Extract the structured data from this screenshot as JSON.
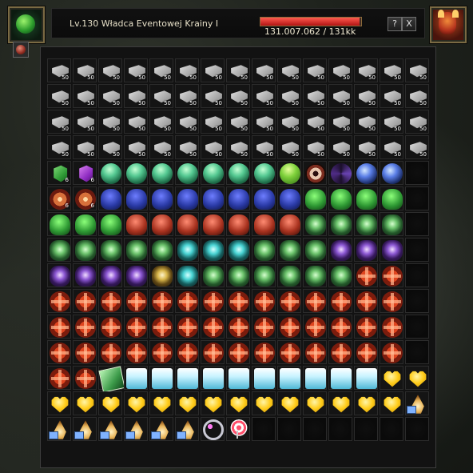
{
  "header": {
    "player_name": "Lv.130 Władca Eventowej Krainy I",
    "hp_text": "131.007.062 / 131kk",
    "hp_fraction": 0.985,
    "help_label": "?",
    "close_label": "X"
  },
  "inventory": {
    "cells": [
      {
        "type": "ingot",
        "qty": "50"
      },
      {
        "type": "ingot",
        "qty": "50"
      },
      {
        "type": "ingot",
        "qty": "50"
      },
      {
        "type": "ingot",
        "qty": "50"
      },
      {
        "type": "ingot",
        "qty": "50"
      },
      {
        "type": "ingot",
        "qty": "50"
      },
      {
        "type": "ingot",
        "qty": "50"
      },
      {
        "type": "ingot",
        "qty": "50"
      },
      {
        "type": "ingot",
        "qty": "50"
      },
      {
        "type": "ingot",
        "qty": "50"
      },
      {
        "type": "ingot",
        "qty": "50"
      },
      {
        "type": "ingot",
        "qty": "50"
      },
      {
        "type": "ingot",
        "qty": "50"
      },
      {
        "type": "ingot",
        "qty": "50"
      },
      {
        "type": "ingot",
        "qty": "50"
      },
      {
        "type": "ingot",
        "qty": "50"
      },
      {
        "type": "ingot",
        "qty": "50"
      },
      {
        "type": "ingot",
        "qty": "50"
      },
      {
        "type": "ingot",
        "qty": "50"
      },
      {
        "type": "ingot",
        "qty": "50"
      },
      {
        "type": "ingot",
        "qty": "50"
      },
      {
        "type": "ingot",
        "qty": "50"
      },
      {
        "type": "ingot",
        "qty": "50"
      },
      {
        "type": "ingot",
        "qty": "50"
      },
      {
        "type": "ingot",
        "qty": "50"
      },
      {
        "type": "ingot",
        "qty": "50"
      },
      {
        "type": "ingot",
        "qty": "50"
      },
      {
        "type": "ingot",
        "qty": "50"
      },
      {
        "type": "ingot",
        "qty": "50"
      },
      {
        "type": "ingot",
        "qty": "50"
      },
      {
        "type": "ingot",
        "qty": "50"
      },
      {
        "type": "ingot",
        "qty": "50"
      },
      {
        "type": "ingot",
        "qty": "50"
      },
      {
        "type": "ingot",
        "qty": "50"
      },
      {
        "type": "ingot",
        "qty": "50"
      },
      {
        "type": "ingot",
        "qty": "50"
      },
      {
        "type": "ingot",
        "qty": "50"
      },
      {
        "type": "ingot",
        "qty": "50"
      },
      {
        "type": "ingot",
        "qty": "50"
      },
      {
        "type": "ingot",
        "qty": "50"
      },
      {
        "type": "ingot",
        "qty": "50"
      },
      {
        "type": "ingot",
        "qty": "50"
      },
      {
        "type": "ingot",
        "qty": "50"
      },
      {
        "type": "ingot",
        "qty": "50"
      },
      {
        "type": "ingot",
        "qty": "50"
      },
      {
        "type": "ingot",
        "qty": "50"
      },
      {
        "type": "ingot",
        "qty": "50"
      },
      {
        "type": "ingot",
        "qty": "50"
      },
      {
        "type": "ingot",
        "qty": "50"
      },
      {
        "type": "ingot",
        "qty": "50"
      },
      {
        "type": "ingot",
        "qty": "50"
      },
      {
        "type": "ingot",
        "qty": "50"
      },
      {
        "type": "ingot",
        "qty": "50"
      },
      {
        "type": "ingot",
        "qty": "50"
      },
      {
        "type": "ingot",
        "qty": "50"
      },
      {
        "type": "ingot",
        "qty": "50"
      },
      {
        "type": "ingot",
        "qty": "50"
      },
      {
        "type": "ingot",
        "qty": "50"
      },
      {
        "type": "ingot",
        "qty": "50"
      },
      {
        "type": "ingot",
        "qty": "50"
      },
      {
        "type": "cube-green",
        "qty": "6"
      },
      {
        "type": "cube-purple",
        "qty": "6"
      },
      {
        "type": "gem-green",
        "qty": ""
      },
      {
        "type": "gem-green",
        "qty": ""
      },
      {
        "type": "gem-green",
        "qty": ""
      },
      {
        "type": "gem-green",
        "qty": ""
      },
      {
        "type": "gem-green",
        "qty": ""
      },
      {
        "type": "gem-green",
        "qty": ""
      },
      {
        "type": "gem-green",
        "qty": ""
      },
      {
        "type": "gem-lime",
        "qty": ""
      },
      {
        "type": "eye",
        "qty": ""
      },
      {
        "type": "vortex",
        "qty": ""
      },
      {
        "type": "orb-blue",
        "qty": ""
      },
      {
        "type": "orb-blue",
        "qty": ""
      },
      {
        "type": "empty",
        "qty": ""
      },
      {
        "type": "flower",
        "qty": "6"
      },
      {
        "type": "flower",
        "qty": "6"
      },
      {
        "type": "flask-blue",
        "qty": ""
      },
      {
        "type": "flask-blue",
        "qty": ""
      },
      {
        "type": "flask-blue",
        "qty": ""
      },
      {
        "type": "flask-blue",
        "qty": ""
      },
      {
        "type": "flask-blue",
        "qty": ""
      },
      {
        "type": "flask-blue",
        "qty": ""
      },
      {
        "type": "flask-blue",
        "qty": ""
      },
      {
        "type": "flask-blue",
        "qty": ""
      },
      {
        "type": "flask-green",
        "qty": ""
      },
      {
        "type": "flask-green",
        "qty": ""
      },
      {
        "type": "flask-green",
        "qty": ""
      },
      {
        "type": "flask-green",
        "qty": ""
      },
      {
        "type": "empty",
        "qty": ""
      },
      {
        "type": "flask-green",
        "qty": ""
      },
      {
        "type": "flask-green",
        "qty": ""
      },
      {
        "type": "flask-green",
        "qty": ""
      },
      {
        "type": "flask-red",
        "qty": ""
      },
      {
        "type": "flask-red",
        "qty": ""
      },
      {
        "type": "flask-red",
        "qty": ""
      },
      {
        "type": "flask-red",
        "qty": ""
      },
      {
        "type": "flask-red",
        "qty": ""
      },
      {
        "type": "flask-red",
        "qty": ""
      },
      {
        "type": "flask-red",
        "qty": ""
      },
      {
        "type": "cage",
        "qty": ""
      },
      {
        "type": "cage",
        "qty": ""
      },
      {
        "type": "cage",
        "qty": ""
      },
      {
        "type": "cage",
        "qty": ""
      },
      {
        "type": "empty",
        "qty": ""
      },
      {
        "type": "cage",
        "qty": ""
      },
      {
        "type": "cage",
        "qty": ""
      },
      {
        "type": "cage",
        "qty": ""
      },
      {
        "type": "cage",
        "qty": ""
      },
      {
        "type": "cage",
        "qty": ""
      },
      {
        "type": "cage-cyan",
        "qty": ""
      },
      {
        "type": "cage-cyan",
        "qty": ""
      },
      {
        "type": "cage-cyan",
        "qty": ""
      },
      {
        "type": "cage",
        "qty": ""
      },
      {
        "type": "cage",
        "qty": ""
      },
      {
        "type": "cage",
        "qty": ""
      },
      {
        "type": "cage-purple",
        "qty": ""
      },
      {
        "type": "cage-purple",
        "qty": ""
      },
      {
        "type": "cage-purple",
        "qty": ""
      },
      {
        "type": "empty",
        "qty": ""
      },
      {
        "type": "cage-purple",
        "qty": ""
      },
      {
        "type": "cage-purple",
        "qty": ""
      },
      {
        "type": "cage-purple",
        "qty": ""
      },
      {
        "type": "cage-purple",
        "qty": ""
      },
      {
        "type": "cage-yellow",
        "qty": ""
      },
      {
        "type": "cage-cyan",
        "qty": ""
      },
      {
        "type": "cage",
        "qty": ""
      },
      {
        "type": "cage",
        "qty": ""
      },
      {
        "type": "cage",
        "qty": ""
      },
      {
        "type": "cage",
        "qty": ""
      },
      {
        "type": "cage",
        "qty": ""
      },
      {
        "type": "cage",
        "qty": ""
      },
      {
        "type": "cross",
        "qty": ""
      },
      {
        "type": "cross",
        "qty": ""
      },
      {
        "type": "empty",
        "qty": ""
      },
      {
        "type": "cross",
        "qty": ""
      },
      {
        "type": "cross",
        "qty": ""
      },
      {
        "type": "cross",
        "qty": ""
      },
      {
        "type": "cross",
        "qty": ""
      },
      {
        "type": "cross",
        "qty": ""
      },
      {
        "type": "cross",
        "qty": ""
      },
      {
        "type": "cross",
        "qty": ""
      },
      {
        "type": "cross",
        "qty": ""
      },
      {
        "type": "cross",
        "qty": ""
      },
      {
        "type": "cross",
        "qty": ""
      },
      {
        "type": "cross",
        "qty": ""
      },
      {
        "type": "cross",
        "qty": ""
      },
      {
        "type": "cross",
        "qty": ""
      },
      {
        "type": "cross",
        "qty": ""
      },
      {
        "type": "empty",
        "qty": ""
      },
      {
        "type": "cross",
        "qty": ""
      },
      {
        "type": "cross",
        "qty": ""
      },
      {
        "type": "cross",
        "qty": ""
      },
      {
        "type": "cross",
        "qty": ""
      },
      {
        "type": "cross",
        "qty": ""
      },
      {
        "type": "cross",
        "qty": ""
      },
      {
        "type": "cross",
        "qty": ""
      },
      {
        "type": "cross",
        "qty": ""
      },
      {
        "type": "cross",
        "qty": ""
      },
      {
        "type": "cross",
        "qty": ""
      },
      {
        "type": "cross",
        "qty": ""
      },
      {
        "type": "cross",
        "qty": ""
      },
      {
        "type": "cross",
        "qty": ""
      },
      {
        "type": "cross",
        "qty": ""
      },
      {
        "type": "empty",
        "qty": ""
      },
      {
        "type": "cross",
        "qty": ""
      },
      {
        "type": "cross",
        "qty": ""
      },
      {
        "type": "cross",
        "qty": ""
      },
      {
        "type": "cross",
        "qty": ""
      },
      {
        "type": "cross",
        "qty": ""
      },
      {
        "type": "cross",
        "qty": ""
      },
      {
        "type": "cross",
        "qty": ""
      },
      {
        "type": "cross",
        "qty": ""
      },
      {
        "type": "cross",
        "qty": ""
      },
      {
        "type": "cross",
        "qty": ""
      },
      {
        "type": "cross",
        "qty": ""
      },
      {
        "type": "cross",
        "qty": ""
      },
      {
        "type": "cross",
        "qty": ""
      },
      {
        "type": "cross",
        "qty": ""
      },
      {
        "type": "empty",
        "qty": ""
      },
      {
        "type": "cross",
        "qty": ""
      },
      {
        "type": "cross",
        "qty": ""
      },
      {
        "type": "book",
        "qty": ""
      },
      {
        "type": "chest",
        "qty": ""
      },
      {
        "type": "chest",
        "qty": ""
      },
      {
        "type": "chest",
        "qty": ""
      },
      {
        "type": "chest",
        "qty": ""
      },
      {
        "type": "chest",
        "qty": ""
      },
      {
        "type": "chest",
        "qty": ""
      },
      {
        "type": "chest",
        "qty": ""
      },
      {
        "type": "chest",
        "qty": ""
      },
      {
        "type": "chest",
        "qty": ""
      },
      {
        "type": "chest",
        "qty": ""
      },
      {
        "type": "heart",
        "qty": ""
      },
      {
        "type": "heart",
        "qty": ""
      },
      {
        "type": "heart",
        "qty": ""
      },
      {
        "type": "heart",
        "qty": ""
      },
      {
        "type": "heart",
        "qty": ""
      },
      {
        "type": "heart",
        "qty": ""
      },
      {
        "type": "heart",
        "qty": ""
      },
      {
        "type": "heart",
        "qty": ""
      },
      {
        "type": "heart",
        "qty": ""
      },
      {
        "type": "heart",
        "qty": ""
      },
      {
        "type": "heart",
        "qty": ""
      },
      {
        "type": "heart",
        "qty": ""
      },
      {
        "type": "heart",
        "qty": ""
      },
      {
        "type": "heart",
        "qty": ""
      },
      {
        "type": "heart",
        "qty": ""
      },
      {
        "type": "heart",
        "qty": ""
      },
      {
        "type": "lamp",
        "qty": ""
      },
      {
        "type": "lamp",
        "qty": ""
      },
      {
        "type": "lamp",
        "qty": ""
      },
      {
        "type": "lamp",
        "qty": ""
      },
      {
        "type": "lamp",
        "qty": ""
      },
      {
        "type": "lamp",
        "qty": ""
      },
      {
        "type": "lamp",
        "qty": ""
      },
      {
        "type": "ring",
        "qty": ""
      },
      {
        "type": "lollipop",
        "qty": ""
      },
      {
        "type": "empty",
        "qty": ""
      },
      {
        "type": "empty",
        "qty": ""
      },
      {
        "type": "empty",
        "qty": ""
      },
      {
        "type": "empty",
        "qty": ""
      },
      {
        "type": "empty",
        "qty": ""
      },
      {
        "type": "empty",
        "qty": ""
      },
      {
        "type": "empty",
        "qty": ""
      }
    ]
  }
}
